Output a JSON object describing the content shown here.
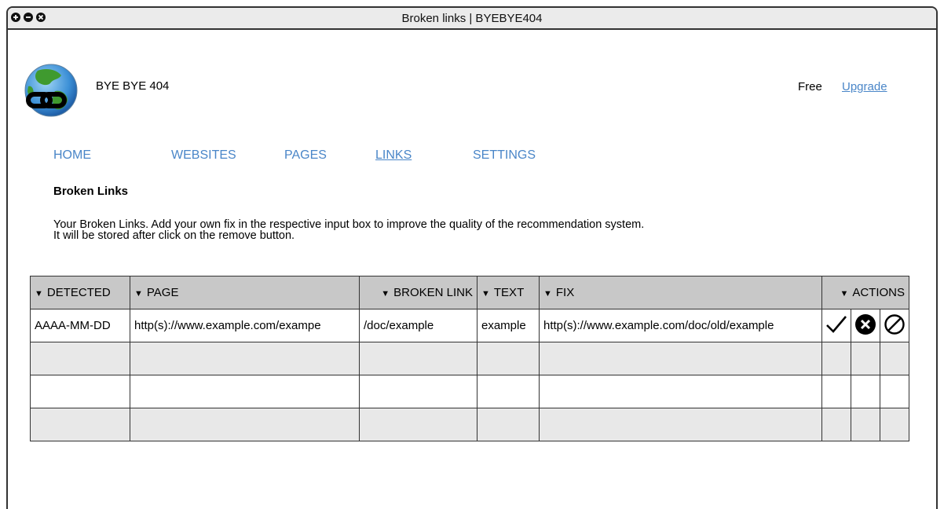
{
  "window": {
    "title": "Broken links | BYEBYE404"
  },
  "header": {
    "brand": "BYE BYE 404",
    "plan": "Free",
    "upgrade_label": "Upgrade"
  },
  "nav": {
    "items": [
      "HOME",
      "WEBSITES",
      "PAGES",
      "LINKS",
      "SETTINGS"
    ],
    "active": "LINKS"
  },
  "main": {
    "heading": "Broken Links",
    "description_line1": "Your Broken Links. Add your own fix in the respective input  box to improve the quality of the recommendation system.",
    "description_line2": "It will be stored after click on the remove button."
  },
  "table": {
    "sort_glyph": "▼",
    "columns": [
      "DETECTED",
      "PAGE",
      "BROKEN LINK",
      "TEXT",
      "FIX",
      "ACTIONS"
    ],
    "rows": [
      {
        "detected": "AAAA-MM-DD",
        "page": "http(s)://www.example.com/exampe",
        "broken_link": "/doc/example",
        "text": "example",
        "fix": "http(s)://www.example.com/doc/old/example"
      }
    ],
    "actions": [
      "check-icon",
      "remove-circle-icon",
      "ignore-icon"
    ]
  },
  "colors": {
    "link": "#4a86c8",
    "header_bg": "#c8c8c8",
    "alt_row": "#e8e8e8",
    "titlebar": "#ebebeb"
  }
}
